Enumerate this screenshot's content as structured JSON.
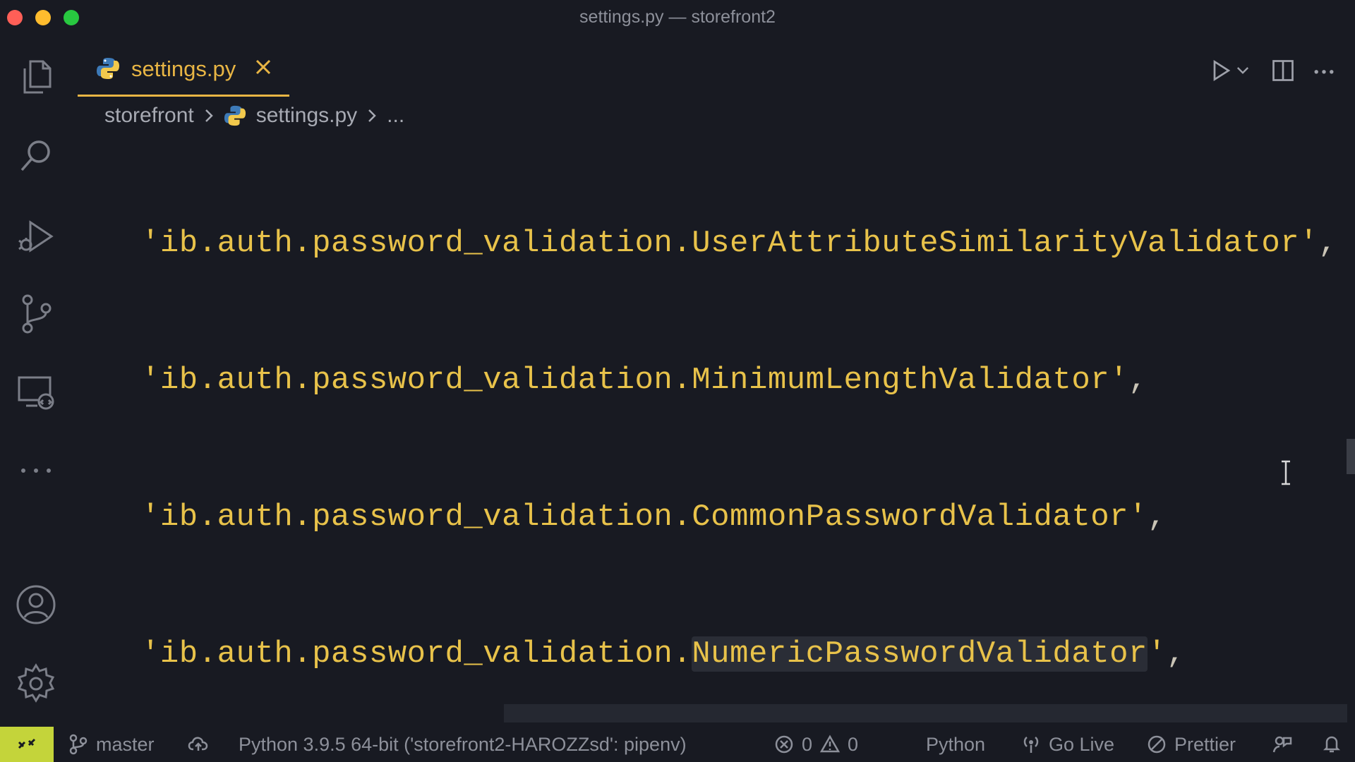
{
  "window": {
    "title": "settings.py — storefront2"
  },
  "activity_bar": {
    "icons": [
      "files-icon",
      "search-icon",
      "run-debug-icon",
      "source-control-icon",
      "remote-explorer-icon",
      "more-icon",
      "account-icon",
      "settings-gear-icon"
    ]
  },
  "tabs": [
    {
      "label": "settings.py",
      "icon": "python-icon",
      "active": true
    }
  ],
  "editor_actions": {
    "icons": [
      "run-icon",
      "chevron-down-icon",
      "split-editor-icon",
      "more-actions-icon"
    ]
  },
  "breadcrumb": {
    "folder": "storefront",
    "file": "settings.py",
    "more": "..."
  },
  "code": {
    "lines": [
      {
        "prefix": "ib.auth.password_validation.",
        "name": "UserAttributeSimilarityValidator",
        "suffix": "'",
        "comma": ","
      },
      {
        "prefix": "ib.auth.password_validation.",
        "name": "MinimumLengthValidator",
        "suffix": "'",
        "comma": ","
      },
      {
        "prefix": "ib.auth.password_validation.",
        "name": "CommonPasswordValidator",
        "suffix": "'",
        "comma": ","
      },
      {
        "prefix": "ib.auth.password_validation.",
        "name": "NumericPasswordValidator",
        "suffix": "'",
        "comma": ","
      }
    ],
    "lead_quote": "'"
  },
  "status_bar": {
    "branch": "master",
    "interpreter": "Python 3.9.5 64-bit ('storefront2-HAROZZsd': pipenv)",
    "errors": "0",
    "warnings": "0",
    "language": "Python",
    "go_live": "Go Live",
    "prettier": "Prettier"
  },
  "colors": {
    "background": "#181a22",
    "accent": "#e8b544",
    "code_string": "#e8c24a",
    "remote_button": "#c4d43a"
  }
}
